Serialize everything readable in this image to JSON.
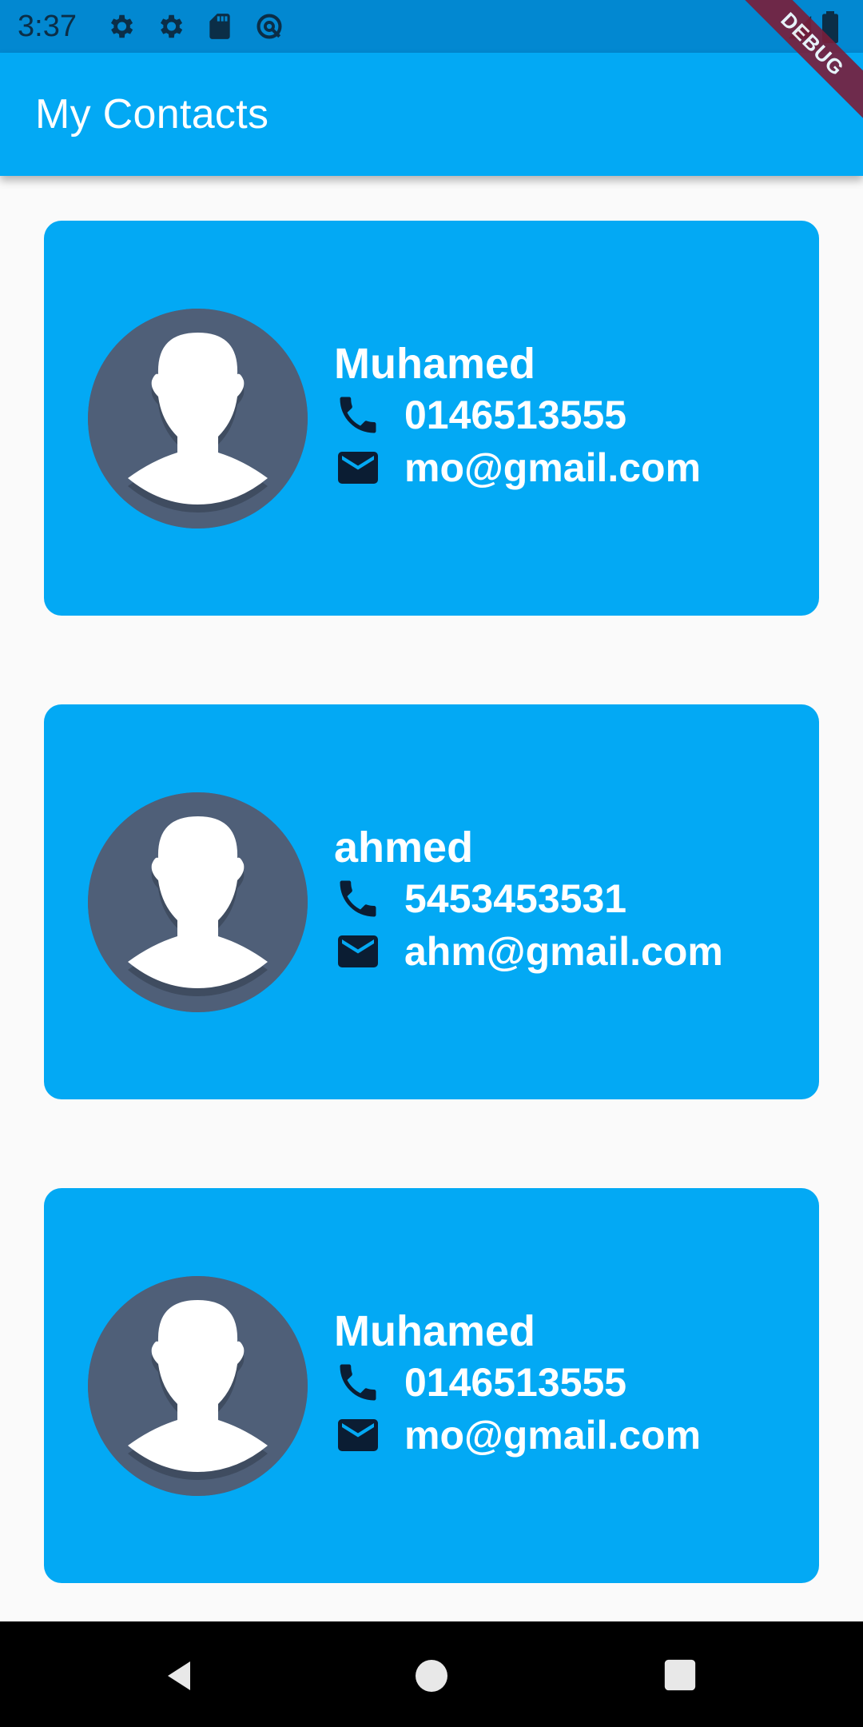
{
  "status_bar": {
    "time": "3:37",
    "icons": [
      "gear-icon",
      "gear-icon",
      "sd-card-icon",
      "no-sync-icon"
    ],
    "right_icons": [
      "signal-icon",
      "battery-icon"
    ]
  },
  "app_bar": {
    "title": "My Contacts",
    "color": "#03a9f4"
  },
  "debug_banner": "DEBUG",
  "contacts": [
    {
      "name": "Muhamed",
      "phone": "0146513555",
      "email": "mo@gmail.com"
    },
    {
      "name": "ahmed",
      "phone": "5453453531",
      "email": "ahm@gmail.com"
    },
    {
      "name": "Muhamed",
      "phone": "0146513555",
      "email": "mo@gmail.com"
    }
  ],
  "nav_bar": {
    "buttons": [
      "back-icon",
      "home-icon",
      "recents-icon"
    ]
  },
  "colors": {
    "card": "#03a9f4",
    "avatar_bg": "#4f5f78",
    "status_bar": "#0288d1"
  }
}
